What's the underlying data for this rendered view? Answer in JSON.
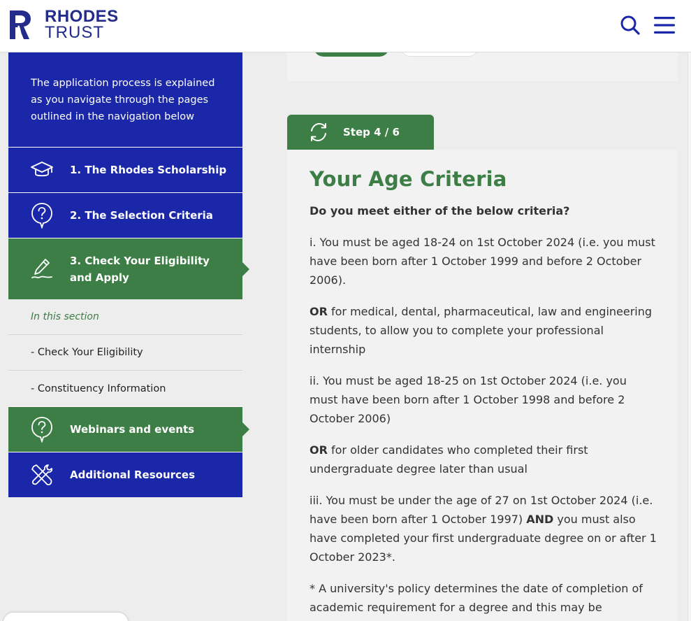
{
  "header": {
    "logo_line1": "RHODES",
    "logo_line2": "TRUST",
    "search_icon": "search-icon",
    "menu_icon": "hamburger-menu-icon"
  },
  "sidebar": {
    "intro": "The application process is explained as you navigate through the pages outlined in the navigation below",
    "items": [
      {
        "label": "1. The Rhodes Scholarship",
        "icon": "graduation-cap-icon"
      },
      {
        "label": "2. The Selection Criteria",
        "icon": "question-bubble-icon"
      },
      {
        "label": "3. Check Your Eligibility and Apply",
        "icon": "pen-writing-icon"
      },
      {
        "label": "Webinars and events",
        "icon": "question-bubble-icon"
      },
      {
        "label": "Additional Resources",
        "icon": "tools-icon"
      }
    ],
    "section_heading": "In this section",
    "sub_items": [
      "- Check Your Eligibility",
      "- Constituency Information"
    ]
  },
  "step": {
    "label": "Step 4 / 6",
    "icon": "refresh-cycle-icon"
  },
  "main": {
    "title": "Your Age Criteria",
    "question": "Do you meet either of the below criteria?",
    "para1": "i. You must be aged 18-24 on 1st October 2024 (i.e. you must have been born after 1 October 1999 and before 2 October 2006).",
    "or1_bold": "OR",
    "or1_text": " for medical, dental, pharmaceutical, law and engineering students, to allow you to complete your professional internship",
    "para2": "ii. You must be aged 18-25 on 1st October 2024 (i.e. you must have been born after 1 October 1998 and before 2 October 2006)",
    "or2_bold": "OR",
    "or2_text": " for older candidates who completed their first undergraduate degree later than usual",
    "para3_a": "iii. You must be under the age of 27 on 1st October 2024 (i.e. have been born after 1 October 1997) ",
    "para3_bold": "AND",
    "para3_b": " you must also have completed your first undergraduate degree on or after 1 October 2023*.",
    "footnote": "* A university's policy determines the date of completion of academic requirement for a degree and this may be"
  },
  "colors": {
    "brand_blue": "#1a27a8",
    "brand_green": "#3c7e45",
    "logo_navy": "#232c8a"
  }
}
